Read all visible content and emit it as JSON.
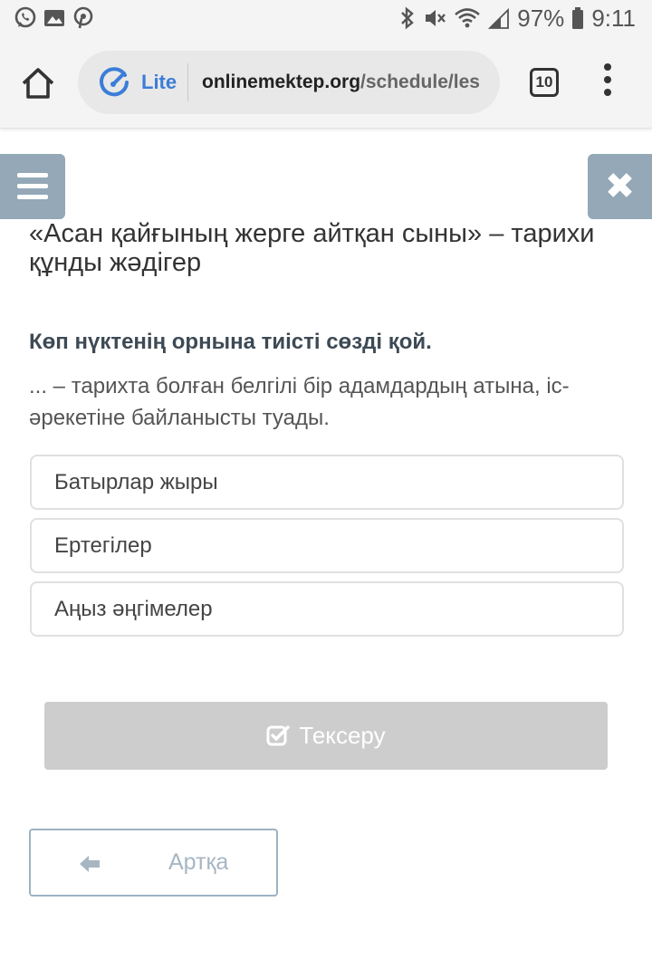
{
  "status_bar": {
    "battery": "97%",
    "time": "9:11",
    "left_icons": [
      "whatsapp-icon",
      "gallery-icon",
      "pinterest-icon"
    ],
    "right_icons": [
      "bluetooth-icon",
      "mute-icon",
      "wifi-icon",
      "signal-icon",
      "battery-icon"
    ]
  },
  "browser": {
    "lite_label": "Lite",
    "url_host": "onlinemektep.org",
    "url_path": "/schedule/les",
    "tab_count": "10"
  },
  "page": {
    "lesson_title": "«Асан қайғының жерге айтқан сыны» – тарихи құнды жәдігер",
    "instruction": "Көп нүктенің орнына тиісті сөзді қой.",
    "question": "... – тарихта болған белгілі бір адамдардың атына, іс-әрекетіне байланысты туады.",
    "options": [
      {
        "label": "Батырлар жыры"
      },
      {
        "label": "Ертегілер"
      },
      {
        "label": "Аңыз әңгімелер"
      }
    ],
    "check_button": "Тексеру",
    "back_button": "Артқа"
  },
  "colors": {
    "side_buttons": "#94a8b7",
    "check_button_disabled": "#cdcdcd",
    "back_button_border": "#9fb3c2",
    "lite_accent": "#3b7dd8"
  }
}
